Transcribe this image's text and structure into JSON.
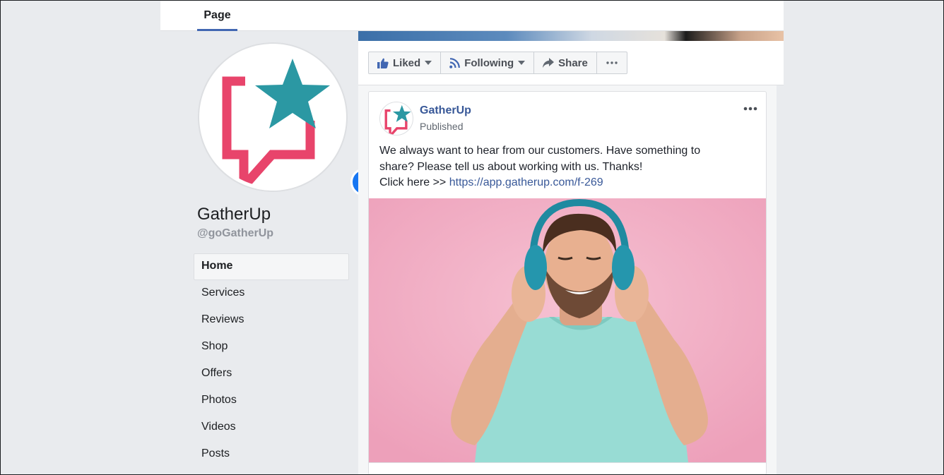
{
  "tabs": {
    "page": "Page"
  },
  "page": {
    "name": "GatherUp",
    "handle": "@goGatherUp"
  },
  "nav": {
    "items": [
      {
        "label": "Home",
        "active": true
      },
      {
        "label": "Services"
      },
      {
        "label": "Reviews"
      },
      {
        "label": "Shop"
      },
      {
        "label": "Offers"
      },
      {
        "label": "Photos"
      },
      {
        "label": "Videos"
      },
      {
        "label": "Posts"
      }
    ]
  },
  "actions": {
    "liked": "Liked",
    "following": "Following",
    "share": "Share",
    "more_icon": "more-horizontal-icon"
  },
  "post": {
    "author": "GatherUp",
    "status": "Published",
    "text_line1": "We always want to hear from our customers. Have something to",
    "text_line2": "share? Please tell us about working with us. Thanks!",
    "text_prefix": "Click here >> ",
    "link": "https://app.gatherup.com/f-269",
    "image_icon": "man-with-headphones-photo"
  },
  "colors": {
    "brand_pink": "#e8446b",
    "brand_teal": "#2b98a3",
    "facebook_blue": "#4267b2",
    "link_blue": "#385898",
    "add_button": "#1877f2"
  }
}
